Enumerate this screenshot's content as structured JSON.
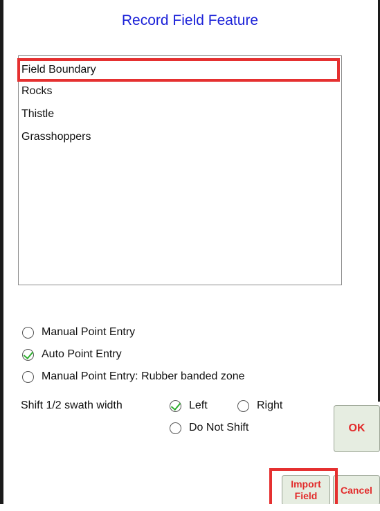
{
  "dialog": {
    "title": "Record Field Feature"
  },
  "features": [
    {
      "label": "Field Boundary",
      "selected": true
    },
    {
      "label": "Rocks",
      "selected": false
    },
    {
      "label": "Thistle",
      "selected": false
    },
    {
      "label": "Grasshoppers",
      "selected": false
    }
  ],
  "entry_mode": {
    "options": [
      {
        "label": "Manual Point Entry",
        "checked": false
      },
      {
        "label": "Auto Point Entry",
        "checked": true
      },
      {
        "label": "Manual Point Entry: Rubber banded zone",
        "checked": false
      }
    ]
  },
  "shift": {
    "label": "Shift 1/2 swath width",
    "options": [
      {
        "label": "Left",
        "checked": true
      },
      {
        "label": "Right",
        "checked": false
      },
      {
        "label": "Do Not Shift",
        "checked": false
      }
    ]
  },
  "buttons": {
    "ok": "OK",
    "import_line1": "Import",
    "import_line2": "Field",
    "cancel": "Cancel"
  },
  "colors": {
    "title": "#1c22d8",
    "highlight": "#e53030",
    "button_text": "#e22b2b",
    "check": "#2fae2f"
  },
  "icons": {
    "check": "checkmark-icon"
  }
}
